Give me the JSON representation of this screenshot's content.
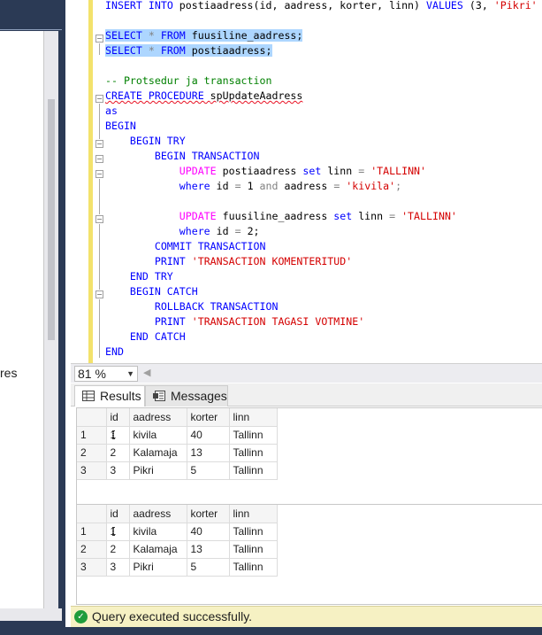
{
  "object_explorer": {
    "visible_fragment": "res"
  },
  "editor": {
    "lines": [
      [
        {
          "t": "INSERT ",
          "c": "kw"
        },
        {
          "t": "INTO ",
          "c": "kw"
        },
        {
          "t": "postiaadress",
          "c": "tx"
        },
        {
          "t": "(id, aadress, korter, linn) ",
          "c": "tx"
        },
        {
          "t": "VALUES ",
          "c": "kw"
        },
        {
          "t": "(3, ",
          "c": "tx"
        },
        {
          "t": "'Pikri'",
          "c": "str"
        }
      ],
      [],
      [
        {
          "t": "SELECT ",
          "c": "kw",
          "s": 1
        },
        {
          "t": "* ",
          "c": "gray",
          "s": 1
        },
        {
          "t": "FROM ",
          "c": "kw",
          "s": 1
        },
        {
          "t": "fuusiline_aadress;",
          "c": "tx",
          "s": 1
        }
      ],
      [
        {
          "t": "SELECT ",
          "c": "kw",
          "s": 1
        },
        {
          "t": "* ",
          "c": "gray",
          "s": 1
        },
        {
          "t": "FROM ",
          "c": "kw",
          "s": 1
        },
        {
          "t": "postiaadress;",
          "c": "tx",
          "s": 1
        }
      ],
      [],
      [
        {
          "t": "-- Protsedur ja transaction",
          "c": "cm"
        }
      ],
      [
        {
          "t": "CREATE PROCEDURE ",
          "c": "kw",
          "w": 1
        },
        {
          "t": "spUpdateAadress",
          "c": "tx",
          "w": 1
        }
      ],
      [
        {
          "t": "as",
          "c": "kw"
        }
      ],
      [
        {
          "t": "BEGIN",
          "c": "kw"
        }
      ],
      [
        {
          "t": "    BEGIN TRY",
          "c": "kw"
        }
      ],
      [
        {
          "t": "        BEGIN TRANSACTION",
          "c": "kw"
        }
      ],
      [
        {
          "t": "            ",
          "c": "tx"
        },
        {
          "t": "UPDATE ",
          "c": "fn"
        },
        {
          "t": "postiaadress ",
          "c": "tx"
        },
        {
          "t": "set ",
          "c": "kw"
        },
        {
          "t": "linn ",
          "c": "tx"
        },
        {
          "t": "= ",
          "c": "gray"
        },
        {
          "t": "'TALLINN'",
          "c": "str"
        }
      ],
      [
        {
          "t": "            ",
          "c": "tx"
        },
        {
          "t": "where ",
          "c": "kw"
        },
        {
          "t": "id ",
          "c": "tx"
        },
        {
          "t": "= ",
          "c": "gray"
        },
        {
          "t": "1 ",
          "c": "tx"
        },
        {
          "t": "and ",
          "c": "gray"
        },
        {
          "t": "aadress ",
          "c": "tx"
        },
        {
          "t": "= ",
          "c": "gray"
        },
        {
          "t": "'kivila'",
          "c": "str"
        },
        {
          "t": ";",
          "c": "gray"
        }
      ],
      [],
      [
        {
          "t": "            ",
          "c": "tx"
        },
        {
          "t": "UPDATE ",
          "c": "fn"
        },
        {
          "t": "fuusiline_aadress ",
          "c": "tx"
        },
        {
          "t": "set ",
          "c": "kw"
        },
        {
          "t": "linn ",
          "c": "tx"
        },
        {
          "t": "= ",
          "c": "gray"
        },
        {
          "t": "'TALLINN'",
          "c": "str"
        }
      ],
      [
        {
          "t": "            ",
          "c": "tx"
        },
        {
          "t": "where ",
          "c": "kw"
        },
        {
          "t": "id ",
          "c": "tx"
        },
        {
          "t": "= ",
          "c": "gray"
        },
        {
          "t": "2;",
          "c": "tx"
        }
      ],
      [
        {
          "t": "        COMMIT TRANSACTION",
          "c": "kw"
        }
      ],
      [
        {
          "t": "        PRINT ",
          "c": "kw"
        },
        {
          "t": "'TRANSACTION KOMENTERITUD'",
          "c": "str"
        }
      ],
      [
        {
          "t": "    END TRY",
          "c": "kw"
        }
      ],
      [
        {
          "t": "    BEGIN CATCH",
          "c": "kw"
        }
      ],
      [
        {
          "t": "        ROLLBACK TRANSACTION",
          "c": "kw"
        }
      ],
      [
        {
          "t": "        PRINT ",
          "c": "kw"
        },
        {
          "t": "'TRANSACTION TAGASI VOTMINE'",
          "c": "str"
        }
      ],
      [
        {
          "t": "    END CATCH",
          "c": "kw"
        }
      ],
      [
        {
          "t": "END",
          "c": "kw"
        }
      ]
    ]
  },
  "zoom": {
    "value": "81 %"
  },
  "results_tabs": {
    "results": "Results",
    "messages": "Messages"
  },
  "grid1": {
    "columns": [
      "id",
      "aadress",
      "korter",
      "linn"
    ],
    "rows": [
      [
        "1",
        "1",
        "kivila",
        "40",
        "Tallinn"
      ],
      [
        "2",
        "2",
        "Kalamaja",
        "13",
        "Tallinn"
      ],
      [
        "3",
        "3",
        "Pikri",
        "5",
        "Tallinn"
      ]
    ]
  },
  "grid2": {
    "columns": [
      "id",
      "aadress",
      "korter",
      "linn"
    ],
    "rows": [
      [
        "1",
        "1",
        "kivila",
        "40",
        "Tallinn"
      ],
      [
        "2",
        "2",
        "Kalamaja",
        "13",
        "Tallinn"
      ],
      [
        "3",
        "3",
        "Pikri",
        "5",
        "Tallinn"
      ]
    ]
  },
  "status": {
    "text": "Query executed successfully."
  }
}
